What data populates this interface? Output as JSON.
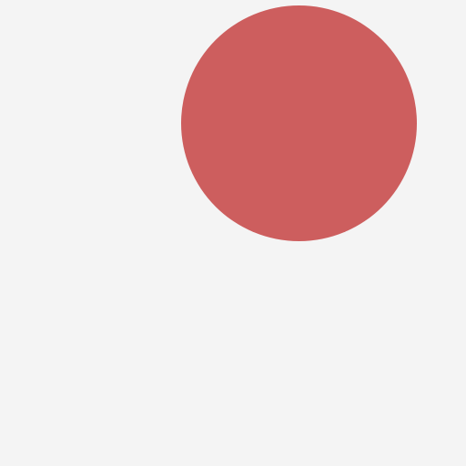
{
  "scene": {
    "background_color": "#f4f4f4",
    "shapes": [
      {
        "kind": "circle",
        "color": "#cd5e5e"
      }
    ]
  }
}
